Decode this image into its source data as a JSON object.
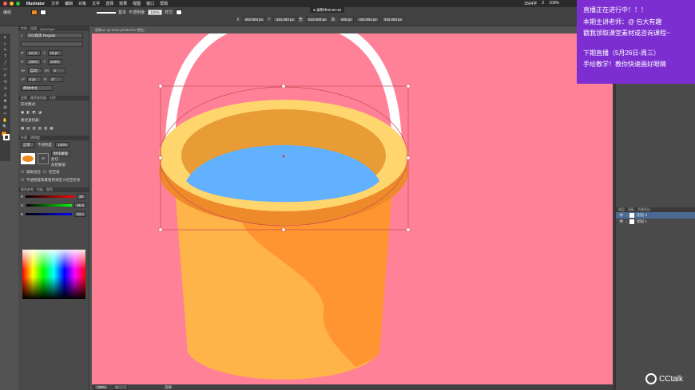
{
  "menubar": {
    "app": "Illustrator",
    "items": [
      "文件",
      "编辑",
      "对象",
      "文字",
      "选择",
      "效果",
      "视图",
      "窗口",
      "帮助"
    ],
    "right": [
      "3564字",
      "2",
      "100%"
    ]
  },
  "controlbar": {
    "mode": "编组",
    "stroke_style": "基本",
    "opacity_label": "不透明度:",
    "opacity": "100%",
    "style_label": "样式:",
    "x_label": "X:",
    "x": "402.904 px",
    "y_label": "Y:",
    "y": "333.493 px",
    "w_label": "宽:",
    "w": "623.083 px",
    "h_label": "高:",
    "h": "400 px",
    "x2": "402.904 px",
    "y2": "333.493 px",
    "timer": "● 录制中00:50:48"
  },
  "document": {
    "tab": "鱼桶.ai* @ 100% (RGB/GPU 预览)"
  },
  "tools": [
    "▸",
    "▹",
    "✎",
    "T",
    "╱",
    "▭",
    "✐",
    "⟲",
    "⇲",
    "◬",
    "✥",
    "⊞",
    "✂",
    "✋",
    "🔍"
  ],
  "character_panel": {
    "tabs": [
      "字符",
      "段落",
      "OpenType"
    ],
    "font": "汉仪旗黑 Regular",
    "size": "12 pt",
    "leading": "18 pt",
    "scale_h": "100%",
    "scale_v": "100%",
    "tracking": "0",
    "kerning": "自动",
    "baseline": "0 pt",
    "rotation": "0°",
    "language": "简体中文"
  },
  "pathfinder": {
    "tabs": [
      "变换",
      "路径查找器",
      "对齐"
    ],
    "shape_modes": "形状模式:",
    "pathfinders": "路径查找器:"
  },
  "appearance": {
    "tabs": [
      "外观",
      "透明度"
    ],
    "blend": "正常",
    "opacity_label": "不透明度:",
    "opacity": "100%",
    "make_mask": "制作蒙版",
    "clip": "剪切",
    "invert": "反相蒙版",
    "isolate": "隔离混合",
    "knockout": "挖空组",
    "define_knockout": "不透明度和蒙版用来定义挖空形状"
  },
  "color_panel": {
    "tabs": [
      "颜色参考",
      "色板",
      "颜色"
    ],
    "r_label": "R",
    "r": "30",
    "g_label": "G",
    "g": "86.8",
    "b_label": "B",
    "b": "93.1"
  },
  "status": {
    "zoom": "100%",
    "page": "1",
    "tool": "选择"
  },
  "layers": {
    "tabs": [
      "图层",
      "画板",
      "资源导出"
    ],
    "items": [
      {
        "name": "图层 2",
        "selected": true
      },
      {
        "name": "图层 1",
        "selected": false
      }
    ]
  },
  "promo": {
    "line1": "直播正在进行中！！！",
    "line2": "本期主讲老师：@ 包大有趣",
    "line3": "戳我领取课堂素材或咨询课程~",
    "line4": "下期直播（5月26日-周三）",
    "line5": "手绘教学！教你快速画好眼睛"
  },
  "watermark": "CCtalk",
  "colors": {
    "canvas_bg": "#ff8197",
    "bucket_body": "#ffb44a",
    "bucket_shade": "#ff9530",
    "rim": "#ffd56e",
    "rim_inner": "#e89c36",
    "water": "#61b1ff",
    "promo_bg": "#7d2ed1",
    "fill_swatch": "#f08a22",
    "selection": "#c94b55"
  }
}
